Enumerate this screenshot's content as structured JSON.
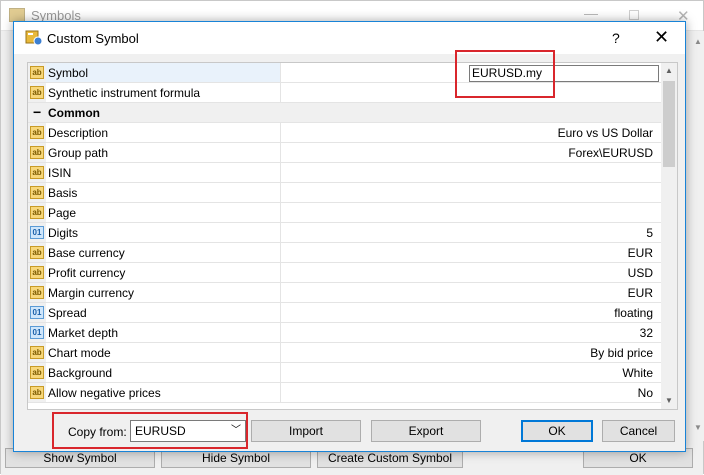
{
  "background_window": {
    "title": "Symbols",
    "buttons": [
      "Show Symbol",
      "Hide Symbol",
      "Create Custom Symbol",
      "OK"
    ]
  },
  "dialog": {
    "title": "Custom Symbol",
    "help": "?",
    "close": "✕"
  },
  "rows": [
    {
      "name": "Symbol",
      "value": "EURUSD.my",
      "icon": "ab"
    },
    {
      "name": "Synthetic instrument formula",
      "value": "",
      "icon": "ab"
    },
    {
      "group": "Common"
    },
    {
      "name": "Description",
      "value": "Euro vs US Dollar",
      "icon": "ab"
    },
    {
      "name": "Group path",
      "value": "Forex\\EURUSD",
      "icon": "ab"
    },
    {
      "name": "ISIN",
      "value": "",
      "icon": "ab"
    },
    {
      "name": "Basis",
      "value": "",
      "icon": "ab"
    },
    {
      "name": "Page",
      "value": "",
      "icon": "ab"
    },
    {
      "name": "Digits",
      "value": "5",
      "icon": "num"
    },
    {
      "name": "Base currency",
      "value": "EUR",
      "icon": "ab"
    },
    {
      "name": "Profit currency",
      "value": "USD",
      "icon": "ab"
    },
    {
      "name": "Margin currency",
      "value": "EUR",
      "icon": "ab"
    },
    {
      "name": "Spread",
      "value": "floating",
      "icon": "num"
    },
    {
      "name": "Market depth",
      "value": "32",
      "icon": "num"
    },
    {
      "name": "Chart mode",
      "value": "By bid price",
      "icon": "ab"
    },
    {
      "name": "Background",
      "value": "White",
      "icon": "ab"
    },
    {
      "name": "Allow negative prices",
      "value": "No",
      "icon": "ab"
    }
  ],
  "icon_text": {
    "ab": "ab",
    "num": "01"
  },
  "bottom": {
    "copy_from_label": "Copy from:",
    "copy_from_value": "EURUSD",
    "import_label": "Import",
    "export_label": "Export",
    "ok_label": "OK",
    "cancel_label": "Cancel"
  },
  "colors": {
    "highlight": "#d9262c",
    "accent": "#0078d7"
  }
}
